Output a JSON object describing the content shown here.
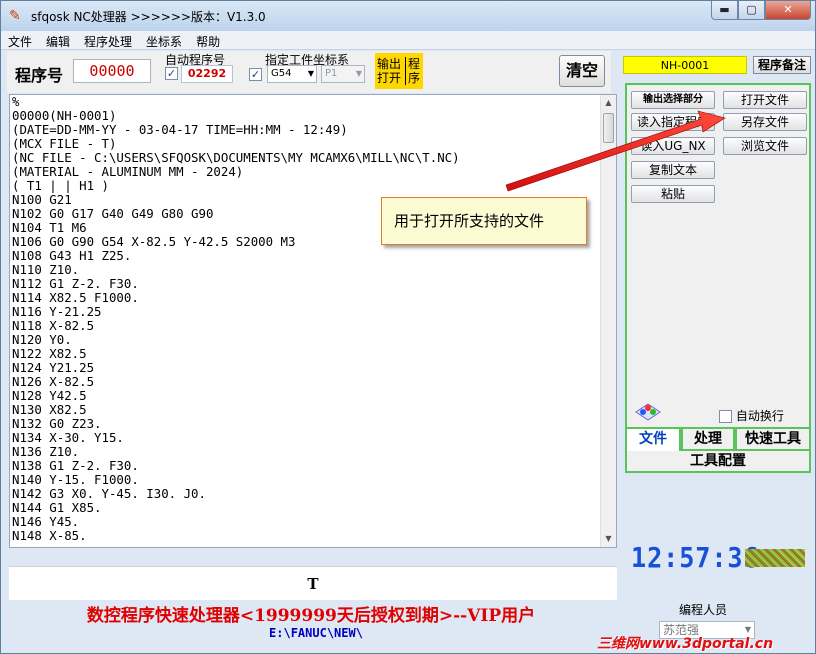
{
  "window": {
    "title": "sfqosk NC处理器 >>>>>>版本：V1.3.0",
    "min_glyph": "▬",
    "max_glyph": "▢",
    "close_glyph": "✕"
  },
  "menu": [
    "文件",
    "编辑",
    "程序处理",
    "坐标系",
    "帮助"
  ],
  "toolbar": {
    "program_label": "程序号",
    "program_number": "00000",
    "auto_program_label": "自动程序号",
    "auto_program_checked": "✓",
    "auto_program_value": "02292",
    "coord_label": "指定工件坐标系",
    "coord_checked": "✓",
    "coord_value": "G54",
    "coord_p_value": "P1",
    "output_open_label_1": "输出",
    "output_open_label_2": "打开",
    "output_program_label_1": "程",
    "output_program_label_2": "序",
    "clear_label": "清空"
  },
  "editor": {
    "lines": [
      "%",
      "00000(NH-0001)",
      "(DATE=DD-MM-YY - 03-04-17 TIME=HH:MM - 12:49)",
      "(MCX FILE - T)",
      "(NC FILE - C:\\USERS\\SFQOSK\\DOCUMENTS\\MY MCAMX6\\MILL\\NC\\T.NC)",
      "(MATERIAL - ALUMINUM MM - 2024)",
      "( T1 | | H1 )",
      "N100 G21",
      "N102 G0 G17 G40 G49 G80 G90",
      "N104 T1 M6",
      "N106 G0 G90 G54 X-82.5 Y-42.5 S2000 M3",
      "N108 G43 H1 Z25.",
      "N110 Z10.",
      "N112 G1 Z-2. F30.",
      "N114 X82.5 F1000.",
      "N116 Y-21.25",
      "N118 X-82.5",
      "N120 Y0.",
      "N122 X82.5",
      "N124 Y21.25",
      "N126 X-82.5",
      "N128 Y42.5",
      "N130 X82.5",
      "N132 G0 Z23.",
      "N134 X-30. Y15.",
      "N136 Z10.",
      "N138 G1 Z-2. F30.",
      "N140 Y-15. F1000.",
      "N142 G3 X0. Y-45. I30. J0.",
      "N144 G1 X85.",
      "N146 Y45.",
      "N148 X-85."
    ],
    "status_char": "T"
  },
  "footer": {
    "auth_text": "数控程序快速处理器<1999999天后授权到期>--VIP用户",
    "path": "E:\\FANUC\\NEW\\"
  },
  "right_panel": {
    "program_name": "NH-0001",
    "note_button": "程序备注",
    "buttons": {
      "output_selection": "输出选择部分",
      "open_file": "打开文件",
      "read_program": "读入指定程序",
      "save_as": "另存文件",
      "read_ug_nx": "读入UG_NX",
      "browse_file": "浏览文件",
      "copy_text": "复制文本",
      "paste": "粘贴"
    },
    "auto_wrap_label": "自动换行",
    "tabs": [
      "文件",
      "处理",
      "快速工具"
    ],
    "tool_config": "工具配置",
    "clock": "12:57:36",
    "programmer_label": "编程人员",
    "programmer_value": "苏范强"
  },
  "callout": {
    "text": "用于打开所支持的文件"
  },
  "watermark": "三维网www.3dportal.cn",
  "colors": {
    "accent_green": "#5ac35a",
    "program_yellow": "#ffff00",
    "output_yellow": "#ffd700",
    "auth_red": "#e00000",
    "path_blue": "#0000c0",
    "clock_blue": "#1a50d8"
  }
}
